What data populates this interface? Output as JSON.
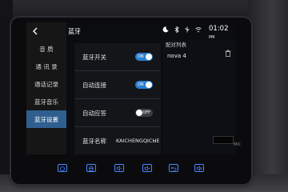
{
  "nav": {
    "items": [
      {
        "label": "音 质"
      },
      {
        "label": "通 讯 录"
      },
      {
        "label": "通话记录"
      },
      {
        "label": "蓝牙音乐"
      },
      {
        "label": "蓝牙设置"
      }
    ],
    "active_index": 4
  },
  "header": {
    "title": "蓝牙"
  },
  "settings": {
    "rows": [
      {
        "label": "蓝牙开关",
        "toggle": "ON"
      },
      {
        "label": "自动连接",
        "toggle": "ON"
      },
      {
        "label": "自动应答",
        "toggle": "OFF"
      },
      {
        "label": "蓝牙名称",
        "value": "KAICHENGQICHE"
      }
    ]
  },
  "paired": {
    "title": "配对列表",
    "devices": [
      "nova 4"
    ]
  },
  "status_bar": {
    "time": "01:02",
    "suffix": "PM",
    "icons": [
      "moon-icon",
      "bluetooth-icon",
      "usb-icon",
      "wifi-icon"
    ]
  },
  "hardware": {
    "buttons": [
      "power-icon",
      "home-icon",
      "volume-down-icon",
      "volume-up-icon",
      "back-icon",
      "volume-mute-icon"
    ],
    "mic_label": "MIC"
  },
  "colors": {
    "accent": "#2a7fd0",
    "nav_active": "#2f5f8e",
    "hw_button": "#4a86ff"
  }
}
